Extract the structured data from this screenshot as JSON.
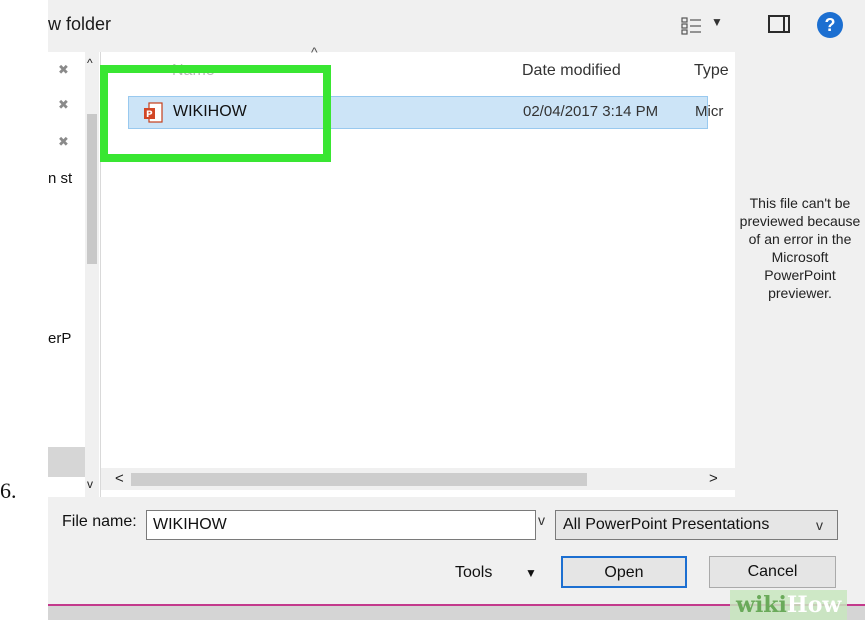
{
  "step_number": "6.",
  "header": {
    "title_fragment": "w folder"
  },
  "nav": {
    "labels": [
      "n st",
      "erP"
    ]
  },
  "columns": {
    "name": "Name",
    "date": "Date modified",
    "type": "Type"
  },
  "file": {
    "name": "WIKIHOW",
    "date": "02/04/2017 3:14 PM",
    "type": "Micr"
  },
  "preview": {
    "message": "This file can't be previewed because of an error in the Microsoft PowerPoint previewer."
  },
  "footer": {
    "file_name_label": "File name:",
    "file_name_value": "WIKIHOW",
    "file_type": "All PowerPoint Presentations",
    "tools": "Tools",
    "open": "Open",
    "cancel": "Cancel"
  },
  "watermark": {
    "part1": "wiki",
    "part2": "How"
  },
  "colors": {
    "highlight": "#39e632",
    "selection": "#cce4f7",
    "accent": "#1c6fd1"
  },
  "icons": [
    "view-options-icon",
    "preview-pane-icon",
    "help-icon",
    "pin-icon",
    "powerpoint-file-icon"
  ]
}
